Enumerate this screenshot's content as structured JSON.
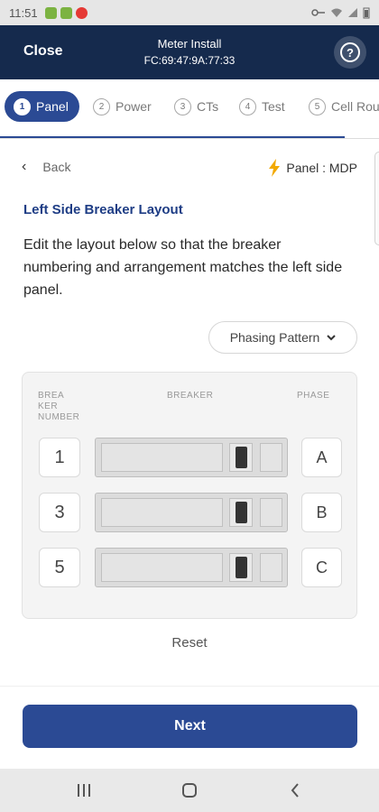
{
  "status_bar": {
    "time": "11:51",
    "icon_colors": [
      "#7cb342",
      "#7cb342",
      "#e53935"
    ]
  },
  "header": {
    "close_label": "Close",
    "title": "Meter Install",
    "subtitle": "FC:69:47:9A:77:33",
    "help_icon": "help-circle-icon",
    "help_glyph": "?"
  },
  "stepper": {
    "steps": [
      {
        "number": "1",
        "label": "Panel",
        "active": true
      },
      {
        "number": "2",
        "label": "Power",
        "active": false
      },
      {
        "number": "3",
        "label": "CTs",
        "active": false
      },
      {
        "number": "4",
        "label": "Test",
        "active": false
      },
      {
        "number": "5",
        "label": "Cell Rou",
        "active": false
      }
    ]
  },
  "content": {
    "back_label": "Back",
    "panel_label": "Panel : MDP",
    "section_title": "Left Side Breaker Layout",
    "instructions": "Edit the layout below so that the breaker numbering and arrangement matches the left side panel.",
    "phasing_button": "Phasing Pattern"
  },
  "breaker_table": {
    "headers": {
      "number_line1": "BREA",
      "number_line2": "KER",
      "number_line3": "NUMBER",
      "breaker": "BREAKER",
      "phase": "PHASE"
    },
    "rows": [
      {
        "number": "1",
        "phase": "A"
      },
      {
        "number": "3",
        "phase": "B"
      },
      {
        "number": "5",
        "phase": "C"
      }
    ]
  },
  "reset_label": "Reset",
  "next_label": "Next",
  "colors": {
    "header_bg": "#152a4d",
    "accent": "#2b4a94",
    "title_text": "#1e3d85",
    "bolt": "#f2a900"
  }
}
